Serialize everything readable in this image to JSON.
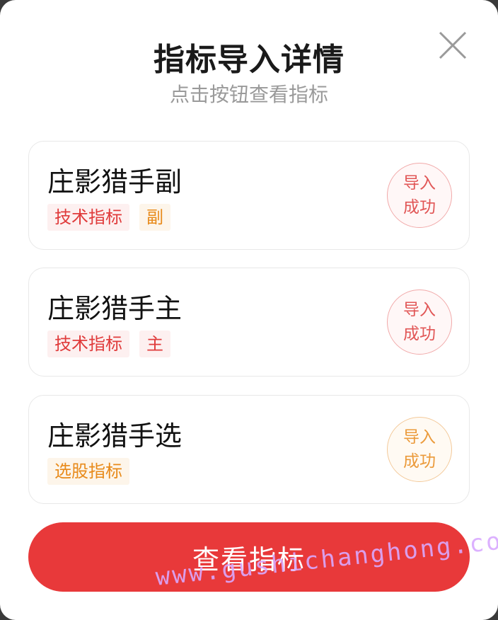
{
  "dialog": {
    "title": "指标导入详情",
    "subtitle": "点击按钮查看指标",
    "close_icon": "close-icon"
  },
  "items": [
    {
      "name": "庄影猎手副",
      "tags": [
        {
          "label": "技术指标",
          "color": "#e03b3b"
        },
        {
          "label": "副",
          "color": "#e88a1a"
        }
      ],
      "status": {
        "line1": "导入",
        "line2": "成功",
        "color": "#e15656"
      }
    },
    {
      "name": "庄影猎手主",
      "tags": [
        {
          "label": "技术指标",
          "color": "#e03b3b"
        },
        {
          "label": "主",
          "color": "#e03b3b"
        }
      ],
      "status": {
        "line1": "导入",
        "line2": "成功",
        "color": "#e15656"
      }
    },
    {
      "name": "庄影猎手选",
      "tags": [
        {
          "label": "选股指标",
          "color": "#e88a1a"
        }
      ],
      "status": {
        "line1": "导入",
        "line2": "成功",
        "color": "#eb9a3a"
      }
    }
  ],
  "action": {
    "label": "查看指标",
    "color": "#e8393a"
  },
  "watermark": "www.gushichanghong.com"
}
